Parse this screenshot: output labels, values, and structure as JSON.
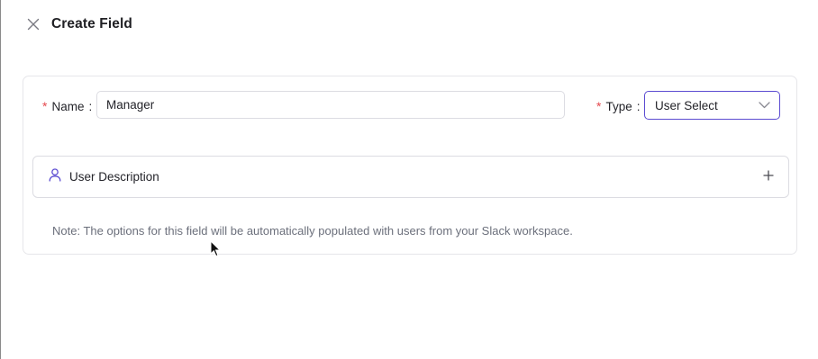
{
  "header": {
    "title": "Create Field",
    "close_icon": "close-icon"
  },
  "form": {
    "name": {
      "required_marker": "*",
      "label": "Name",
      "separator": ":",
      "value": "Manager",
      "placeholder": ""
    },
    "type": {
      "required_marker": "*",
      "label": "Type",
      "separator": ":",
      "selected": "User Select",
      "icon": "chevron-down-icon"
    },
    "description": {
      "label": "User Description",
      "leading_icon": "user-icon",
      "action_icon": "plus-icon"
    },
    "note": "Note: The options for this field will be automatically populated with users from your Slack workspace."
  },
  "colors": {
    "required": "#e5484d",
    "accent": "#5b4bd1",
    "note_text": "#6b6f7b",
    "border": "#dcdce2"
  }
}
